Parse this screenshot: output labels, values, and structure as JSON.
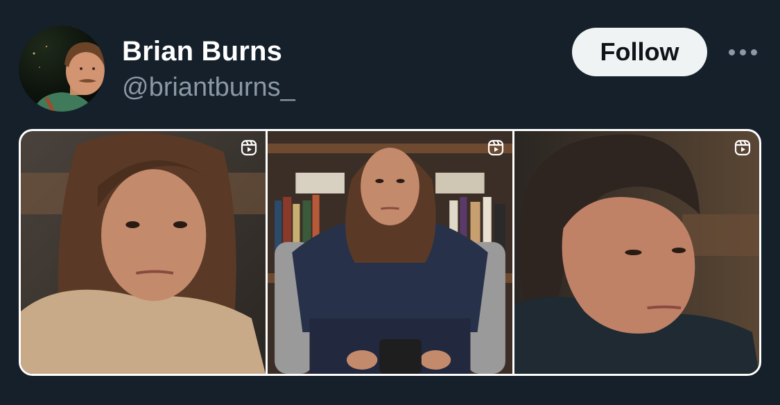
{
  "tweet": {
    "author": {
      "display_name": "Brian Burns",
      "handle": "@briantburns_"
    },
    "follow_label": "Follow",
    "more_icon": "more-horizontal-icon",
    "media": [
      {
        "type": "reel",
        "icon": "instagram-reels-icon"
      },
      {
        "type": "reel",
        "icon": "instagram-reels-icon"
      },
      {
        "type": "reel",
        "icon": "instagram-reels-icon"
      }
    ]
  },
  "colors": {
    "background": "#15202b",
    "name": "#ffffff",
    "handle": "#8b98a5",
    "follow_bg": "#eff3f4",
    "follow_text": "#0f1419"
  }
}
